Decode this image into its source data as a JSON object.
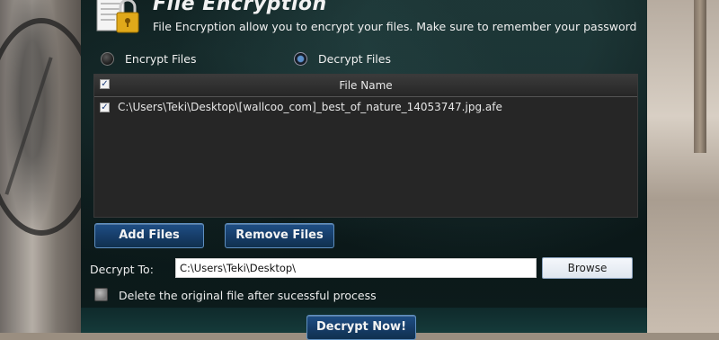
{
  "window": {
    "title": "File Encryption",
    "subtitle": "File Encryption allow you to encrypt your files. Make sure to remember your password"
  },
  "mode": {
    "options": [
      {
        "label": "Encrypt Files",
        "selected": false
      },
      {
        "label": "Decrypt Files",
        "selected": true
      }
    ]
  },
  "file_list": {
    "header": "File Name",
    "header_checked": true,
    "rows": [
      {
        "checked": true,
        "name": "C:\\Users\\Teki\\Desktop\\[wallcoo_com]_best_of_nature_14053747.jpg.afe"
      }
    ]
  },
  "buttons": {
    "add": "Add Files",
    "remove": "Remove Files",
    "browse": "Browse",
    "decrypt_now": "Decrypt Now!"
  },
  "decrypt_to": {
    "label": "Decrypt To:",
    "value": "C:\\Users\\Teki\\Desktop\\"
  },
  "options": {
    "delete_original_label": "Delete the original file after sucessful process",
    "delete_original_checked": false
  },
  "icons": {
    "header": "document-lock-icon",
    "check": "checkmark-icon"
  },
  "colors": {
    "panel_bg": "#0b1717",
    "button_blue": "#173e6a",
    "list_bg": "#262626"
  }
}
